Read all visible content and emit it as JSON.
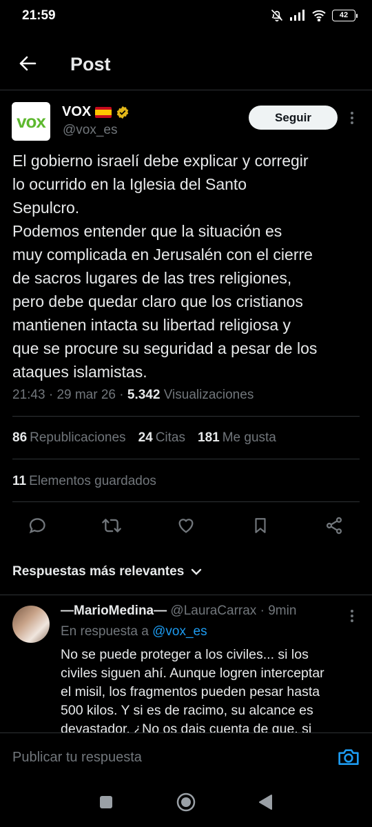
{
  "status_bar": {
    "time": "21:59",
    "battery": "42"
  },
  "header": {
    "title": "Post"
  },
  "author": {
    "avatar_text": "vox",
    "name": "VOX",
    "handle": "@vox_es",
    "follow_label": "Seguir"
  },
  "tweet": {
    "lines": [
      "El gobierno israelí debe explicar y corregir",
      "lo ocurrido en la Iglesia del  Santo",
      "Sepulcro.",
      "Podemos entender que la situación es",
      "muy complicada en Jerusalén con el cierre",
      "de sacros lugares de las tres religiones,",
      "pero debe quedar claro que los cristianos",
      "mantienen intacta su libertad religiosa y",
      "que se procure su seguridad a pesar de los",
      "ataques islamistas."
    ],
    "time": "21:43",
    "date": "29 mar 26",
    "views": "5.342",
    "views_label": "Visualizaciones"
  },
  "stats": {
    "reposts": "86",
    "reposts_label": "Republicaciones",
    "quotes": "24",
    "quotes_label": "Citas",
    "likes": "181",
    "likes_label": "Me gusta",
    "bookmarks": "11",
    "bookmarks_label": "Elementos guardados"
  },
  "replies_sort": {
    "label": "Respuestas más relevantes"
  },
  "reply": {
    "name": "—MarioMedina—",
    "handle": "@LauraCarrax",
    "time": "9min",
    "replying_prefix": "En respuesta a",
    "replying_to": "@vox_es",
    "lines": [
      "No se puede proteger a los civiles... si los",
      "civiles siguen ahí. Aunque logren interceptar",
      "el misil, los fragmentos pueden pesar hasta",
      "500 kilos. Y si es de racimo, su alcance es",
      "devastador. ¿No os dais cuenta de que, si"
    ]
  },
  "compose": {
    "placeholder": "Publicar tu respuesta"
  },
  "colors": {
    "background": "#000000",
    "accent": "#1d9bf0",
    "vox_green": "#5db82e",
    "muted": "#71767b",
    "verified": "#e2b719"
  }
}
